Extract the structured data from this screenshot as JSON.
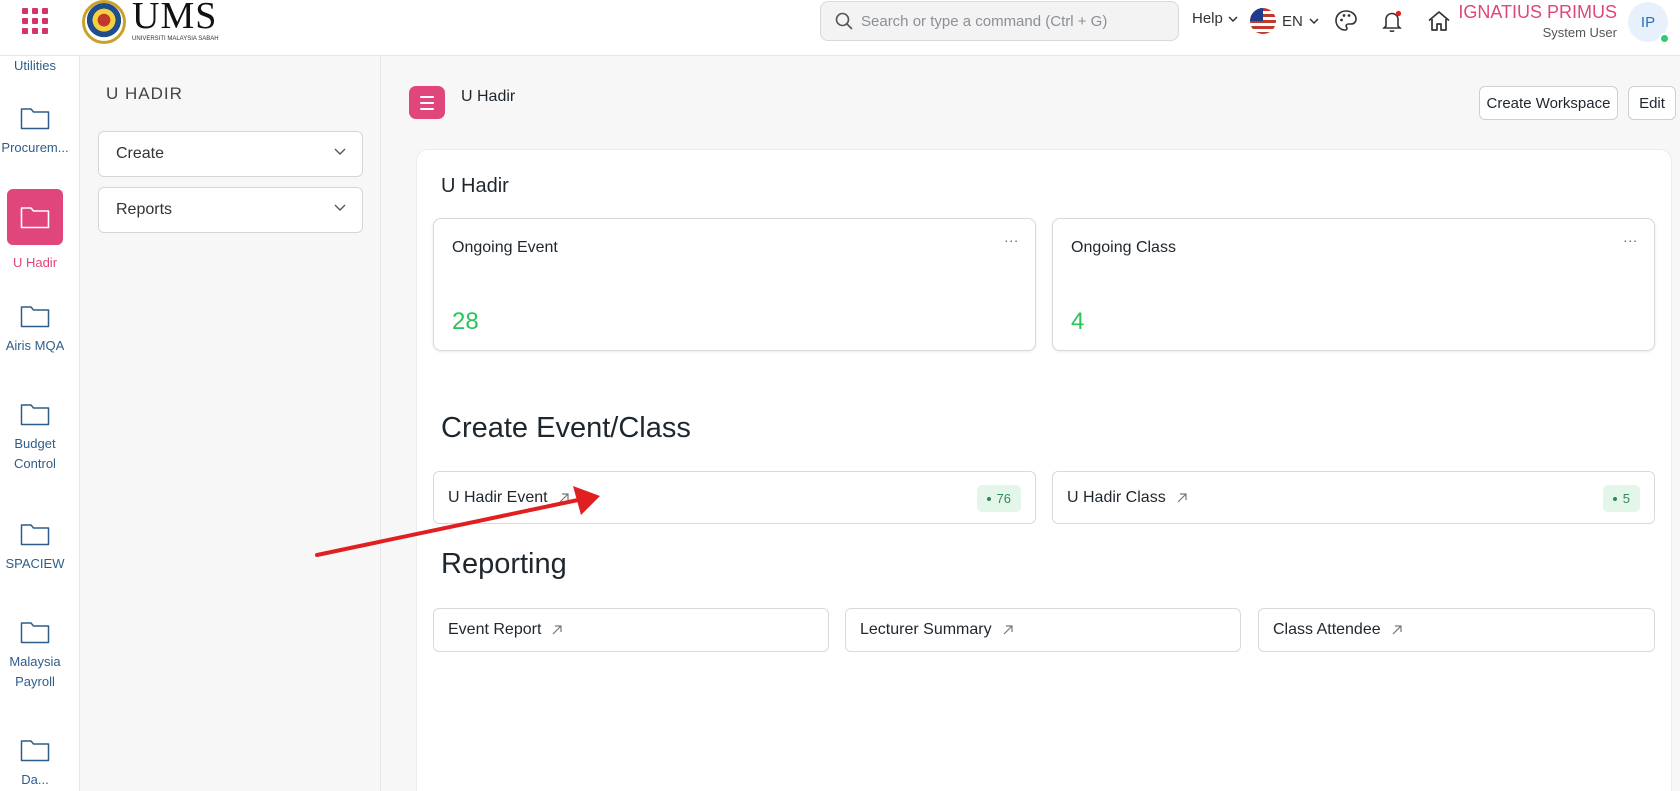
{
  "navbar": {
    "logo_text": "UMS",
    "logo_subtitle": "UNIVERSITI MALAYSIA SABAH",
    "search_placeholder": "Search or type a command (Ctrl + G)",
    "help_label": "Help",
    "language_label": "EN",
    "user_name": "IGNATIUS PRIMUS",
    "user_role": "System User",
    "avatar_initials": "IP"
  },
  "rail": {
    "top_label": "Utilities",
    "items": [
      {
        "label": "Procurem..."
      },
      {
        "label": "U Hadir",
        "active": true
      },
      {
        "label": "Airis MQA"
      },
      {
        "label": "Budget\nControl"
      },
      {
        "label": "SPACIEW"
      },
      {
        "label": "Malaysia\nPayroll"
      },
      {
        "label": "Da..."
      }
    ]
  },
  "workspace_sidebar": {
    "title": "U HADIR",
    "dropdowns": [
      {
        "label": "Create"
      },
      {
        "label": "Reports"
      }
    ]
  },
  "page": {
    "title": "U Hadir",
    "create_workspace_label": "Create Workspace",
    "edit_label": "Edit"
  },
  "main": {
    "section_title": "U Hadir",
    "number_cards": [
      {
        "title": "Ongoing Event",
        "value": "28",
        "more": "..."
      },
      {
        "title": "Ongoing Class",
        "value": "4",
        "more": "..."
      }
    ],
    "create_title": "Create Event/Class",
    "shortcuts": [
      {
        "label": "U Hadir Event",
        "count": "76"
      },
      {
        "label": "U Hadir Class",
        "count": "5"
      }
    ],
    "reporting_title": "Reporting",
    "reports": [
      {
        "label": "Event Report"
      },
      {
        "label": "Lecturer Summary"
      },
      {
        "label": "Class Attendee"
      }
    ]
  },
  "colors": {
    "accent": "#e0457b",
    "value_green": "#29c45a",
    "annotation_red": "#e02020"
  }
}
